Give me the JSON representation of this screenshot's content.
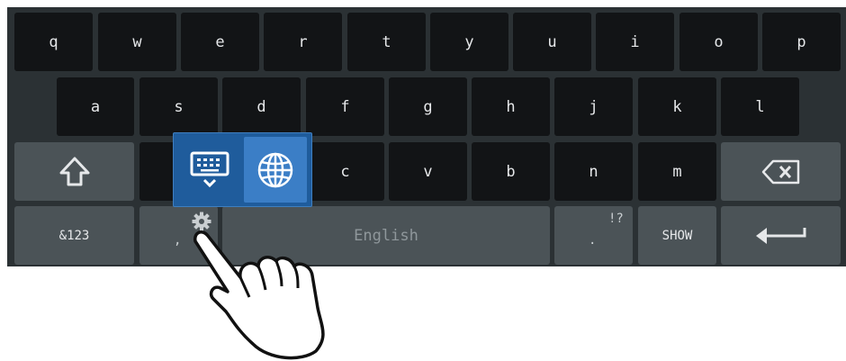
{
  "rows": {
    "row1": [
      "q",
      "w",
      "e",
      "r",
      "t",
      "y",
      "u",
      "i",
      "o",
      "p"
    ],
    "row2": [
      "a",
      "s",
      "d",
      "f",
      "g",
      "h",
      "j",
      "k",
      "l"
    ],
    "row3": [
      "c",
      "v",
      "b",
      "n",
      "m"
    ]
  },
  "keys": {
    "shift_icon": "shift-arrow-up",
    "backspace_icon": "backspace",
    "symbols_label": "&123",
    "settings_icon": "gear",
    "comma_label": ",",
    "space_label": "English",
    "period_label": ".",
    "punct_hint": "!?",
    "show_label": "SHOW",
    "enter_icon": "enter-arrow"
  },
  "popup": {
    "items": [
      {
        "icon": "keyboard-hide",
        "selected": false
      },
      {
        "icon": "globe",
        "selected": true
      }
    ]
  },
  "colors": {
    "keyboard_bg": "#2b3134",
    "letter_key": "#121416",
    "function_key": "#4b5357",
    "popup_bg": "#1f5c9c",
    "popup_selected": "#3b7ec6"
  }
}
